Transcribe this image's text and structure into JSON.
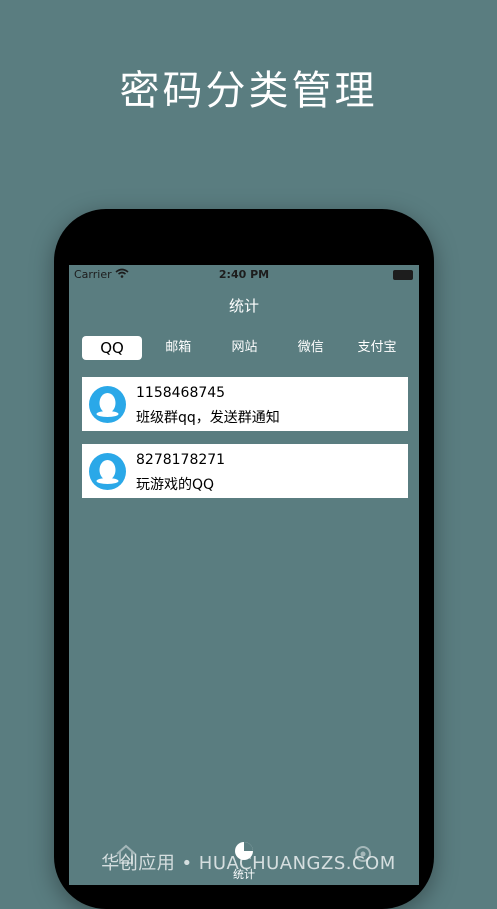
{
  "promo": {
    "headline": "密码分类管理"
  },
  "status_bar": {
    "carrier": "Carrier",
    "time": "2:40 PM"
  },
  "nav": {
    "title": "统计"
  },
  "tabs": [
    {
      "label": "QQ",
      "active": true
    },
    {
      "label": "邮箱",
      "active": false
    },
    {
      "label": "网站",
      "active": false
    },
    {
      "label": "微信",
      "active": false
    },
    {
      "label": "支付宝",
      "active": false
    }
  ],
  "entries": [
    {
      "account": "1158468745",
      "note": "班级群qq，发送群通知",
      "icon": "qq-penguin-icon"
    },
    {
      "account": "8278178271",
      "note": "玩游戏的QQ",
      "icon": "qq-penguin-icon"
    }
  ],
  "tab_bar": {
    "stats_label": "统计"
  },
  "watermark": "华创应用 • HUACHUANGZS.COM",
  "colors": {
    "background": "#5a7d80",
    "avatar": "#2aa8e8",
    "card": "#ffffff"
  }
}
